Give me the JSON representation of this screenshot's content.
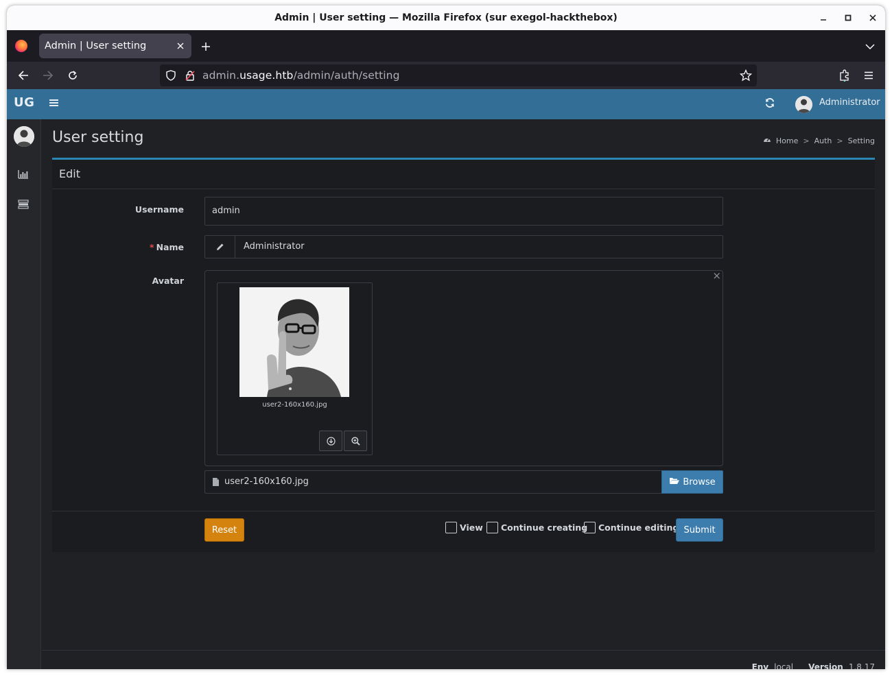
{
  "window": {
    "title": "Admin | User setting — Mozilla Firefox (sur exegol-hackthebox)"
  },
  "browser": {
    "tab_title": "Admin | User setting",
    "url_prefix": "admin.",
    "url_host": "usage.htb",
    "url_path": "/admin/auth/setting"
  },
  "app": {
    "brand": "UG",
    "user_name": "Administrator"
  },
  "page": {
    "title": "User setting",
    "breadcrumb": [
      "Home",
      "Auth",
      "Setting"
    ]
  },
  "form": {
    "box_title": "Edit",
    "username_label": "Username",
    "username_value": "admin",
    "name_required_mark": "*",
    "name_label": "Name",
    "name_value": "Administrator",
    "avatar_label": "Avatar",
    "avatar_filename": "user2-160x160.jpg",
    "file_caption": "user2-160x160.jpg",
    "browse_label": "Browse",
    "reset_label": "Reset",
    "check_view": "View",
    "check_continue_creating": "Continue creating",
    "check_continue_editing": "Continue editing",
    "submit_label": "Submit"
  },
  "footer": {
    "env_label": "Env",
    "env_value": "local",
    "version_label": "Version",
    "version_value": "1.8.17"
  },
  "colors": {
    "header_blue": "#326e96",
    "primary": "#3c7dae",
    "warning": "#d4830f",
    "box_accent": "#2a86b3"
  }
}
